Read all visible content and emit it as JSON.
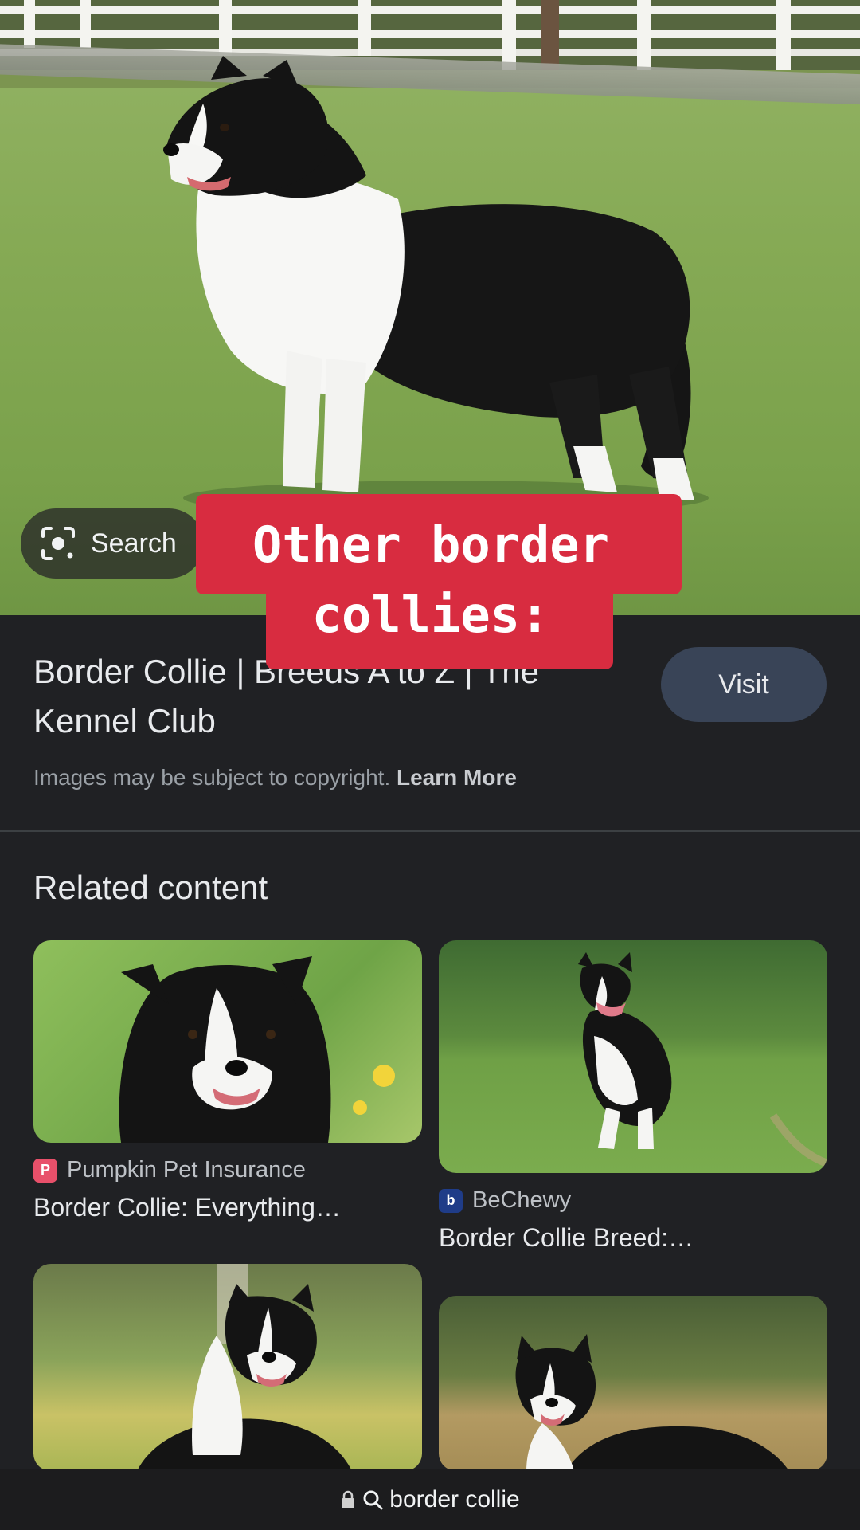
{
  "hero": {
    "search_button_label": "Search",
    "caption": "Other border collies:"
  },
  "result": {
    "title": "Border Collie | Breeds A to Z | The Kennel Club",
    "visit_label": "Visit",
    "copyright_text": "Images may be subject to copyright.",
    "learn_more_label": "Learn More"
  },
  "related": {
    "heading": "Related content",
    "items": [
      {
        "source": "Pumpkin Pet Insurance",
        "title": "Border Collie: Everything…",
        "favicon_color": "#e8506a"
      },
      {
        "source": "BeChewy",
        "title": "Border Collie Breed:…",
        "favicon_color": "#1f3c88"
      },
      {
        "source": "",
        "title": ""
      },
      {
        "source": "",
        "title": ""
      }
    ]
  },
  "urlbar": {
    "query": "border collie"
  },
  "colors": {
    "background": "#202124",
    "caption_bg": "#d82c40",
    "visit_bg": "#394457"
  }
}
